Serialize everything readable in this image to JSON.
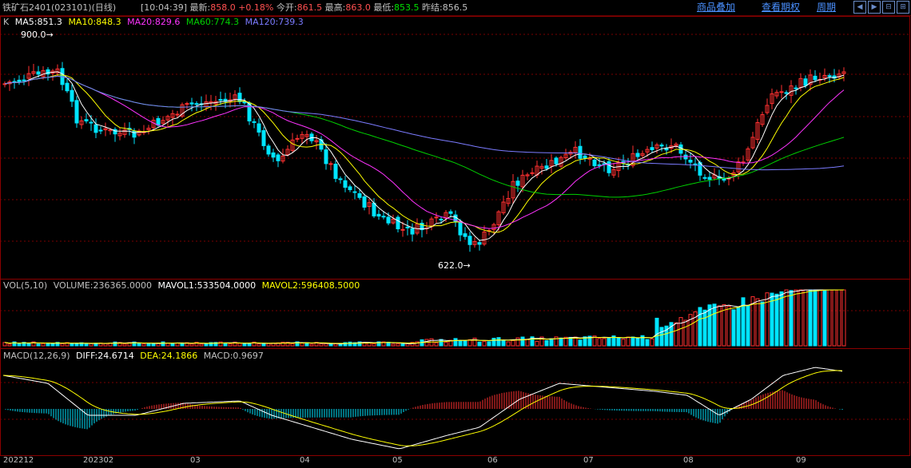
{
  "header": {
    "title": "铁矿石2401(023101)(日线)",
    "time": "[10:04:39]",
    "latest_label": "最新:",
    "latest_value": "858.0",
    "change": "+0.18%",
    "open_label": "今开:",
    "open_value": "861.5",
    "high_label": "最高:",
    "high_value": "863.0",
    "low_label": "最低:",
    "low_value": "853.5",
    "prev_label": "昨结:",
    "prev_value": "856.5",
    "links": [
      "商品叠加",
      "查看期权",
      "周期"
    ],
    "nav_buttons": [
      "◀",
      "▶",
      "⊟",
      "⊞"
    ]
  },
  "main": {
    "legend": [
      {
        "text": "K",
        "color": "#c0c0c0"
      },
      {
        "text": "MA5:851.3",
        "color": "#ffffff"
      },
      {
        "text": "MA10:848.3",
        "color": "#ffff00"
      },
      {
        "text": "MA20:829.6",
        "color": "#ff33ff"
      },
      {
        "text": "MA60:774.3",
        "color": "#00d000"
      },
      {
        "text": "MA120:739.3",
        "color": "#7b7bff"
      }
    ],
    "high_marker": "900.0",
    "low_marker": "622.0"
  },
  "volume": {
    "legend": [
      {
        "text": "VOL(5,10)",
        "color": "#c0c0c0"
      },
      {
        "text": "VOLUME:236365.0000",
        "color": "#c0c0c0"
      },
      {
        "text": "MAVOL1:533504.0000",
        "color": "#ffffff"
      },
      {
        "text": "MAVOL2:596408.5000",
        "color": "#ffff00"
      }
    ]
  },
  "macd": {
    "legend": [
      {
        "text": "MACD(12,26,9)",
        "color": "#c0c0c0"
      },
      {
        "text": "DIFF:24.6714",
        "color": "#ffffff"
      },
      {
        "text": "DEA:24.1866",
        "color": "#ffff00"
      },
      {
        "text": "MACD:0.9697",
        "color": "#c0c0c0"
      }
    ]
  },
  "x_axis": [
    "202212",
    "202302",
    "03",
    "04",
    "05",
    "06",
    "07",
    "08",
    "09"
  ],
  "colors": {
    "up": "#ff3030",
    "down": "#00e5ff",
    "grid": "#7a0000"
  }
}
